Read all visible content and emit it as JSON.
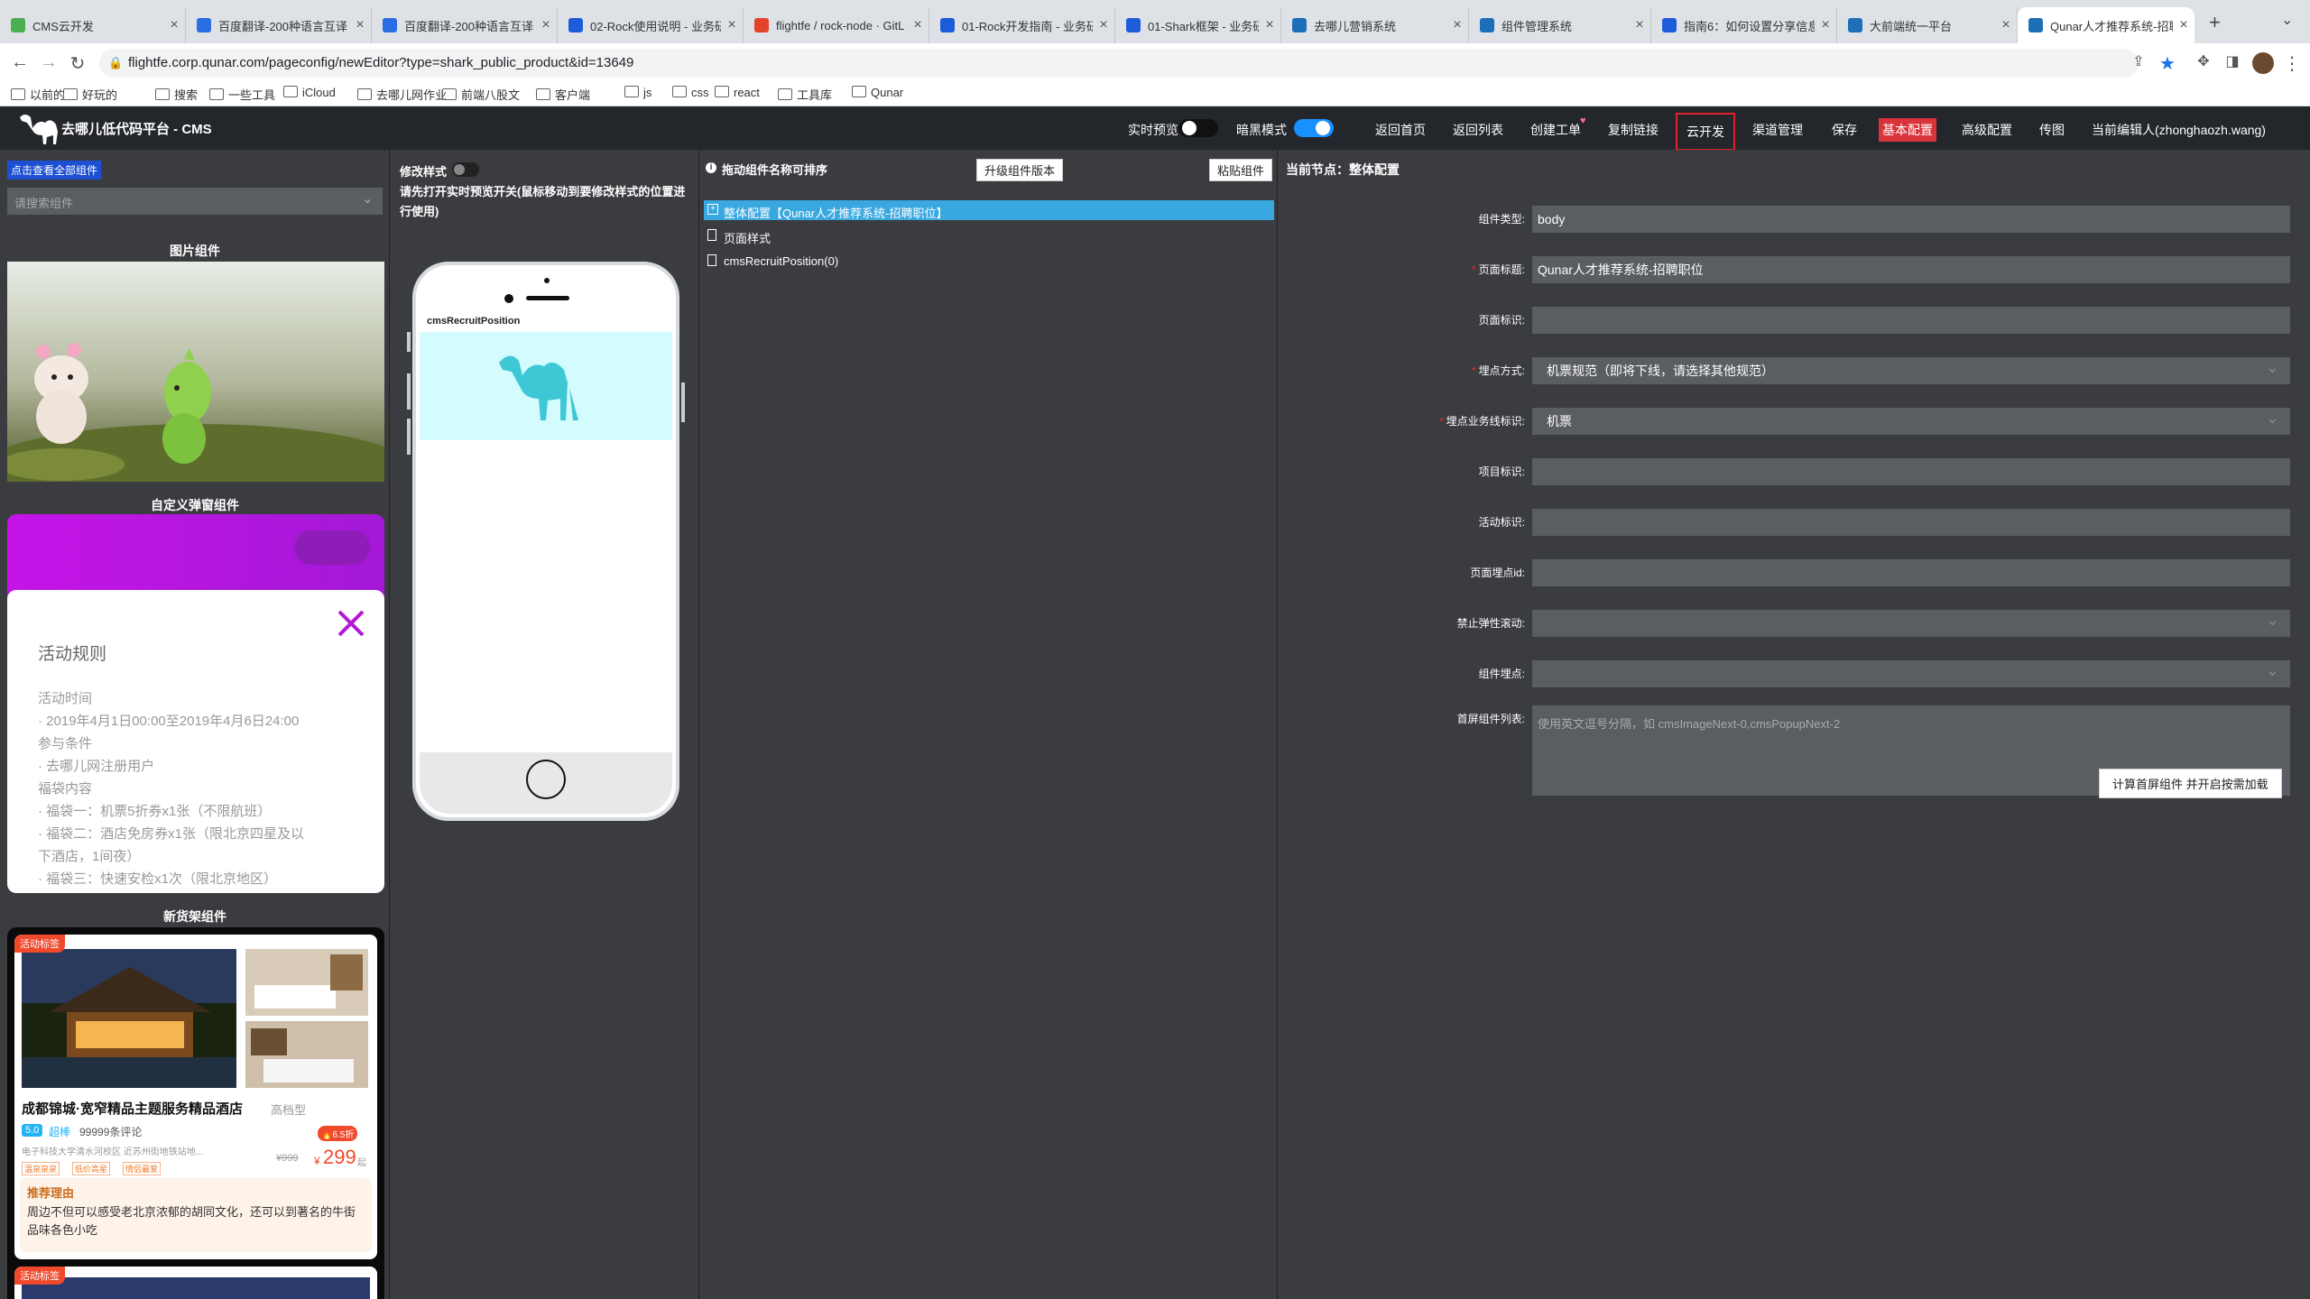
{
  "browser": {
    "tabs": [
      {
        "title": "CMS云开发",
        "fav": "#4caf50"
      },
      {
        "title": "百度翻译-200种语言互译",
        "fav": "#2b6de5"
      },
      {
        "title": "百度翻译-200种语言互译",
        "fav": "#2b6de5"
      },
      {
        "title": "02-Rock使用说明 - 业务研",
        "fav": "#1c5cd8"
      },
      {
        "title": "flightfe / rock-node · GitL",
        "fav": "#e24329"
      },
      {
        "title": "01-Rock开发指南 - 业务研",
        "fav": "#1c5cd8"
      },
      {
        "title": "01-Shark框架 - 业务研发",
        "fav": "#1c5cd8"
      },
      {
        "title": "去哪儿营销系统",
        "fav": "#1d6fb8"
      },
      {
        "title": "组件管理系统",
        "fav": "#1d6fb8"
      },
      {
        "title": "指南6：如何设置分享信息",
        "fav": "#1c5cd8"
      },
      {
        "title": "大前端统一平台",
        "fav": "#1d6fb8"
      },
      {
        "title": "Qunar人才推荐系统-招聘",
        "fav": "#1d6fb8"
      }
    ],
    "url": "flightfe.corp.qunar.com/pageconfig/newEditor?type=shark_public_product&id=13649",
    "bookmarks": [
      "以前的",
      "好玩的",
      "搜索",
      "一些工具",
      "iCloud",
      "去哪儿网作业",
      "前端八股文",
      "客户端",
      "js",
      "css",
      "react",
      "工具库",
      "Qunar"
    ]
  },
  "app": {
    "title": "去哪儿低代码平台 - CMS",
    "realtime_preview_label": "实时预览",
    "dark_mode_label": "暗黑模式",
    "nav": [
      "返回首页",
      "返回列表",
      "创建工单",
      "复制链接",
      "云开发",
      "渠道管理",
      "保存",
      "基本配置",
      "高级配置",
      "传图",
      "当前编辑人(zhonghaozh.wang)"
    ]
  },
  "left": {
    "view_all_button": "点击查看全部组件",
    "search_placeholder": "请搜索组件",
    "section_image": "图片组件",
    "section_popup": "自定义弹窗组件",
    "popup": {
      "title": "活动规则",
      "lines": [
        "活动时间",
        "· 2019年4月1日00:00至2019年4月6日24:00",
        "参与条件",
        "· 去哪儿网注册用户",
        "福袋内容",
        "· 福袋一：机票5折券x1张（不限航班）",
        "· 福袋二：酒店免房券x1张（限北京四星及以",
        "下酒店，1间夜）",
        "· 福袋三：快速安检x1次（限北京地区）"
      ]
    },
    "section_goods": "新货架组件",
    "goods": {
      "tag": "活动标签",
      "hotel_name": "成都锦城·宽窄精品主题服务精品酒店",
      "hotel_grade": "高档型",
      "score": "5.0",
      "score_word": "超棒",
      "reviews": "99999条评论",
      "location": "电子科技大学清水河校区 近苏州街地铁站地...",
      "tags": [
        "温泉泉泉",
        "低价高星",
        "情侣最爱"
      ],
      "discount": "6.5折",
      "old_price": "¥999",
      "price_symbol": "¥",
      "price": "299",
      "price_unit": "起",
      "reason_title": "推荐理由",
      "reason_text": "周边不但可以感受老北京浓郁的胡同文化，还可以到著名的牛街品味各色小吃",
      "tag2": "活动标签"
    }
  },
  "middle": {
    "edit_style_label": "修改样式",
    "hint": "请先打开实时预览开关(鼠标移动到要修改样式的位置进行使用)",
    "phone_component_label": "cmsRecruitPosition"
  },
  "tree": {
    "header": "拖动组件名称可排序",
    "upgrade_button": "升级组件版本",
    "paste_button": "粘贴组件",
    "nodes": [
      "整体配置【Qunar人才推荐系统-招聘职位】",
      "页面样式",
      "cmsRecruitPosition(0)"
    ]
  },
  "props": {
    "current_node": "当前节点：整体配置",
    "fields": [
      {
        "label": "组件类型:",
        "required": false,
        "value": "body",
        "select": false
      },
      {
        "label": "页面标题:",
        "required": true,
        "value": "Qunar人才推荐系统-招聘职位",
        "select": false
      },
      {
        "label": "页面标识:",
        "required": false,
        "value": "",
        "select": false
      },
      {
        "label": "埋点方式:",
        "required": true,
        "value": "机票规范（即将下线，请选择其他规范）",
        "select": true
      },
      {
        "label": "埋点业务线标识:",
        "required": true,
        "value": "机票",
        "select": true
      },
      {
        "label": "项目标识:",
        "required": false,
        "value": "",
        "select": false
      },
      {
        "label": "活动标识:",
        "required": false,
        "value": "",
        "select": false
      },
      {
        "label": "页面埋点id:",
        "required": false,
        "value": "",
        "select": false
      },
      {
        "label": "禁止弹性滚动:",
        "required": false,
        "value": "",
        "select": true
      },
      {
        "label": "组件埋点:",
        "required": false,
        "value": "",
        "select": true
      }
    ],
    "first_screen_label": "首屏组件列表:",
    "first_screen_placeholder": "使用英文逗号分隔，如 cmsImageNext-0,cmsPopupNext-2",
    "calc_button": "计算首屏组件 并开启按需加载"
  }
}
